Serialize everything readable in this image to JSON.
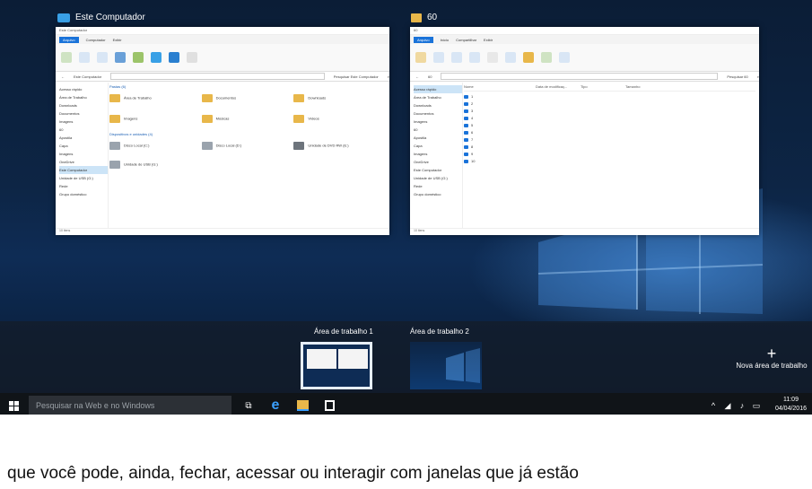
{
  "windows": [
    {
      "caption": "Este Computador",
      "titlebar": "Este Computador",
      "tabs": [
        "Arquivo",
        "Computador",
        "Exibir"
      ],
      "address": "Este Computador",
      "search_placeholder": "Pesquisar Este Computador",
      "nav": [
        "Acesso rápido",
        "Área de Trabalho",
        "Downloads",
        "Documentos",
        "Imagens",
        "60",
        "Apostila",
        "Capa",
        "Imagens",
        "OneDrive",
        "Este Computador",
        "Unidade de USB (G:)",
        "Rede",
        "Grupo doméstico"
      ],
      "section_folders": "Pastas (6)",
      "folders": [
        "Área de Trabalho",
        "Documentos",
        "Downloads",
        "Imagens",
        "Músicas",
        "Vídeos"
      ],
      "section_drives": "Dispositivos e unidades (4)",
      "drives": [
        "Disco Local (C:)",
        "Disco Local (D:)",
        "Unidade de DVD RW (E:)",
        "Unidade de USB (G:)"
      ],
      "status": "10 itens"
    },
    {
      "caption": "60",
      "titlebar": "60",
      "tabs": [
        "Arquivo",
        "Início",
        "Compartilhar",
        "Exibir"
      ],
      "address": "60",
      "search_placeholder": "Pesquisar 60",
      "nav": [
        "Acesso rápido",
        "Área de Trabalho",
        "Downloads",
        "Documentos",
        "Imagens",
        "60",
        "Apostila",
        "Capa",
        "Imagens",
        "OneDrive",
        "Este Computador",
        "Unidade de USB (G:)",
        "Rede",
        "Grupo doméstico"
      ],
      "columns": [
        "Nome",
        "Data de modificaç...",
        "Tipo",
        "Tamanho"
      ],
      "files": [
        "1",
        "2",
        "3",
        "4",
        "5",
        "6",
        "7",
        "8",
        "9",
        "10"
      ],
      "status": "10 itens"
    }
  ],
  "desktops": [
    "Área de trabalho 1",
    "Área de trabalho 2"
  ],
  "new_desktop": "Nova área de trabalho",
  "taskbar": {
    "search_placeholder": "Pesquisar na Web e no Windows",
    "time": "11:09",
    "date": "04/04/2016"
  },
  "caption_text": "que você pode, ainda, fechar, acessar ou interagir com janelas que já estão",
  "colors": {
    "accent": "#1a73d9",
    "desktop": "#0e2c55",
    "taskbar": "#101418",
    "folder": "#e8b74a"
  }
}
